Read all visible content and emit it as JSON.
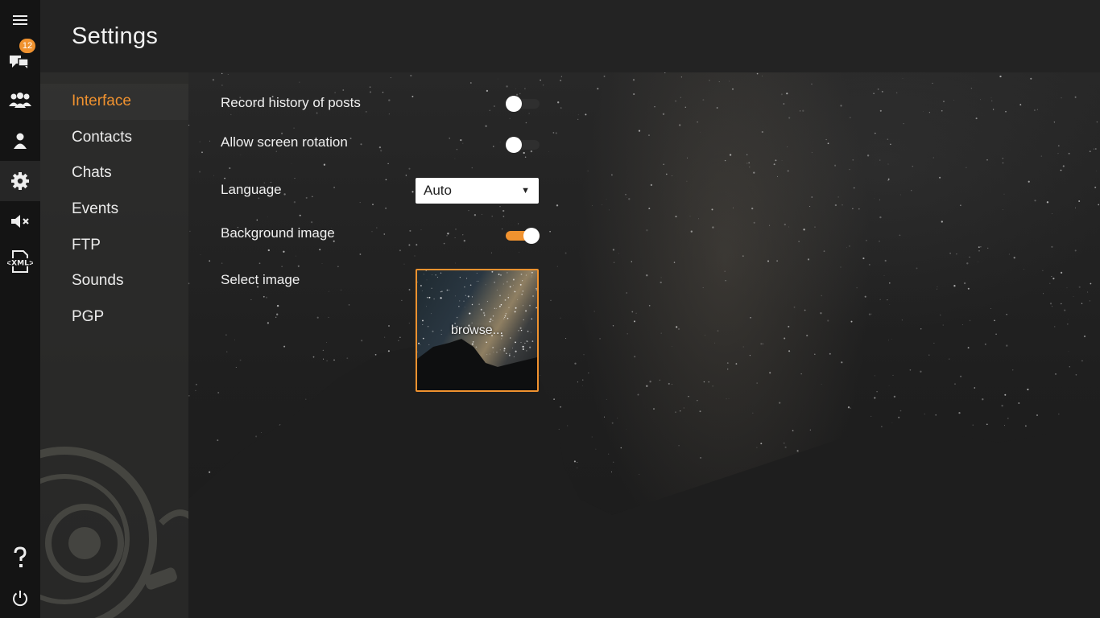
{
  "app": {
    "page_title": "Settings",
    "accent_color": "#f0922f"
  },
  "rail": {
    "items": [
      {
        "name": "menu",
        "icon": "hamburger-menu-icon"
      },
      {
        "name": "chats",
        "icon": "chat-bubbles-icon",
        "badge": "12"
      },
      {
        "name": "contacts",
        "icon": "group-icon"
      },
      {
        "name": "account",
        "icon": "person-icon"
      },
      {
        "name": "settings",
        "icon": "gear-icon",
        "active": true
      },
      {
        "name": "sound",
        "icon": "speaker-mute-icon"
      },
      {
        "name": "xml-console",
        "icon": "xml-console-icon"
      },
      {
        "name": "help",
        "icon": "question-mark-icon"
      },
      {
        "name": "power",
        "icon": "power-icon"
      }
    ]
  },
  "nav": {
    "items": [
      {
        "label": "Interface",
        "active": true
      },
      {
        "label": "Contacts"
      },
      {
        "label": "Chats"
      },
      {
        "label": "Events"
      },
      {
        "label": "FTP"
      },
      {
        "label": "Sounds"
      },
      {
        "label": "PGP"
      }
    ]
  },
  "settings": {
    "record_history": {
      "label": "Record history of posts",
      "enabled": false
    },
    "screen_rotation": {
      "label": "Allow screen rotation",
      "enabled": false
    },
    "language": {
      "label": "Language",
      "value": "Auto"
    },
    "background_image": {
      "label": "Background image",
      "enabled": true
    },
    "select_image": {
      "label": "Select image",
      "button_label": "browse..."
    }
  }
}
